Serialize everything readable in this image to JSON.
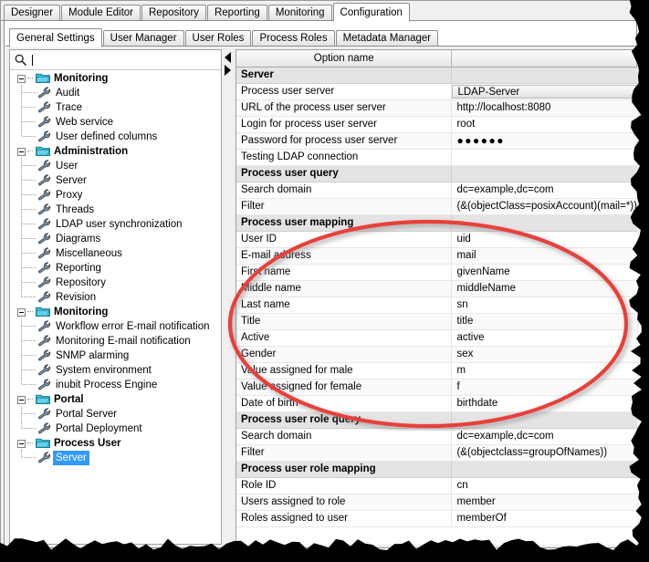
{
  "window": {
    "outer_tabs": [
      {
        "label": "Designer",
        "active": false
      },
      {
        "label": "Module Editor",
        "active": false
      },
      {
        "label": "Repository",
        "active": false
      },
      {
        "label": "Reporting",
        "active": false
      },
      {
        "label": "Monitoring",
        "active": false
      },
      {
        "label": "Configuration",
        "active": true
      }
    ],
    "inner_tabs": [
      {
        "label": "General Settings",
        "active": true
      },
      {
        "label": "User Manager",
        "active": false
      },
      {
        "label": "User Roles",
        "active": false
      },
      {
        "label": "Process Roles",
        "active": false
      },
      {
        "label": "Metadata Manager",
        "active": false
      }
    ]
  },
  "search": {
    "value": "",
    "placeholder": "",
    "icon": "search-icon"
  },
  "splitter": {
    "collapse_left_icon": "triangle-left-icon",
    "collapse_right_icon": "triangle-right-icon"
  },
  "tree": {
    "folder_icon": "folder-icon",
    "leaf_icon": "wrench-icon",
    "nodes": [
      {
        "label": "Monitoring",
        "type": "group",
        "expanded": true
      },
      {
        "label": "Audit",
        "type": "leaf"
      },
      {
        "label": "Trace",
        "type": "leaf"
      },
      {
        "label": "Web service",
        "type": "leaf"
      },
      {
        "label": "User defined columns",
        "type": "leaf",
        "last": true
      },
      {
        "label": "Administration",
        "type": "group",
        "expanded": true
      },
      {
        "label": "User",
        "type": "leaf"
      },
      {
        "label": "Server",
        "type": "leaf"
      },
      {
        "label": "Proxy",
        "type": "leaf"
      },
      {
        "label": "Threads",
        "type": "leaf"
      },
      {
        "label": "LDAP user synchronization",
        "type": "leaf"
      },
      {
        "label": "Diagrams",
        "type": "leaf"
      },
      {
        "label": "Miscellaneous",
        "type": "leaf"
      },
      {
        "label": "Reporting",
        "type": "leaf"
      },
      {
        "label": "Repository",
        "type": "leaf"
      },
      {
        "label": "Revision",
        "type": "leaf",
        "last": true
      },
      {
        "label": "Monitoring",
        "type": "group",
        "expanded": true
      },
      {
        "label": "Workflow error E-mail notification",
        "type": "leaf"
      },
      {
        "label": "Monitoring E-mail notification",
        "type": "leaf"
      },
      {
        "label": "SNMP alarming",
        "type": "leaf"
      },
      {
        "label": "System environment",
        "type": "leaf"
      },
      {
        "label": "inubit Process Engine",
        "type": "leaf",
        "last": true
      },
      {
        "label": "Portal",
        "type": "group",
        "expanded": true
      },
      {
        "label": "Portal Server",
        "type": "leaf"
      },
      {
        "label": "Portal Deployment",
        "type": "leaf",
        "last": true
      },
      {
        "label": "Process User",
        "type": "group",
        "expanded": true
      },
      {
        "label": "Server",
        "type": "leaf",
        "last": true,
        "selected": true
      }
    ]
  },
  "options_table": {
    "columns": [
      "Option name",
      ""
    ],
    "rows": [
      {
        "name": "Server",
        "value": "",
        "type": "section"
      },
      {
        "name": "Process user server",
        "value": "LDAP-Server",
        "type": "combo"
      },
      {
        "name": "URL of the process user server",
        "value": "http://localhost:8080",
        "type": "text"
      },
      {
        "name": "Login for process user server",
        "value": "root",
        "type": "text"
      },
      {
        "name": "Password for process user server",
        "value": "●●●●●●",
        "type": "password"
      },
      {
        "name": "Testing LDAP connection",
        "value": "",
        "type": "text"
      },
      {
        "name": "Process user query",
        "value": "",
        "type": "section"
      },
      {
        "name": "Search domain",
        "value": "dc=example,dc=com",
        "type": "text"
      },
      {
        "name": "Filter",
        "value": "(&(objectClass=posixAccount)(mail=*))",
        "type": "text"
      },
      {
        "name": "Process user mapping",
        "value": "",
        "type": "section"
      },
      {
        "name": "User ID",
        "value": "uid",
        "type": "text"
      },
      {
        "name": "E-mail address",
        "value": "mail",
        "type": "text"
      },
      {
        "name": "First name",
        "value": "givenName",
        "type": "text"
      },
      {
        "name": "Middle name",
        "value": "middleName",
        "type": "text"
      },
      {
        "name": "Last name",
        "value": "sn",
        "type": "text"
      },
      {
        "name": "Title",
        "value": "title",
        "type": "text"
      },
      {
        "name": "Active",
        "value": "active",
        "type": "text"
      },
      {
        "name": "Gender",
        "value": "sex",
        "type": "text"
      },
      {
        "name": "Value assigned for male",
        "value": "m",
        "type": "text"
      },
      {
        "name": "Value assigned for female",
        "value": "f",
        "type": "text"
      },
      {
        "name": "Date of birth",
        "value": "birthdate",
        "type": "text"
      },
      {
        "name": "Process user role query",
        "value": "",
        "type": "section"
      },
      {
        "name": "Search domain",
        "value": "dc=example,dc=com",
        "type": "text"
      },
      {
        "name": "Filter",
        "value": "(&(objectclass=groupOfNames))",
        "type": "text"
      },
      {
        "name": "Process user role mapping",
        "value": "",
        "type": "section"
      },
      {
        "name": "Role ID",
        "value": "cn",
        "type": "text"
      },
      {
        "name": "Users assigned to role",
        "value": "member",
        "type": "text"
      },
      {
        "name": "Roles assigned to user",
        "value": "memberOf",
        "type": "text"
      }
    ]
  },
  "annotation": {
    "shape": "ellipse",
    "color": "#e8403a",
    "highlights_section": "Process user mapping"
  },
  "colors": {
    "selection": "#3399ff",
    "section_header_bg": "#e4e4e4",
    "annotation_red": "#e8403a",
    "folder_icon": "#39b8d8",
    "wrench_icon": "#6b7d92"
  }
}
